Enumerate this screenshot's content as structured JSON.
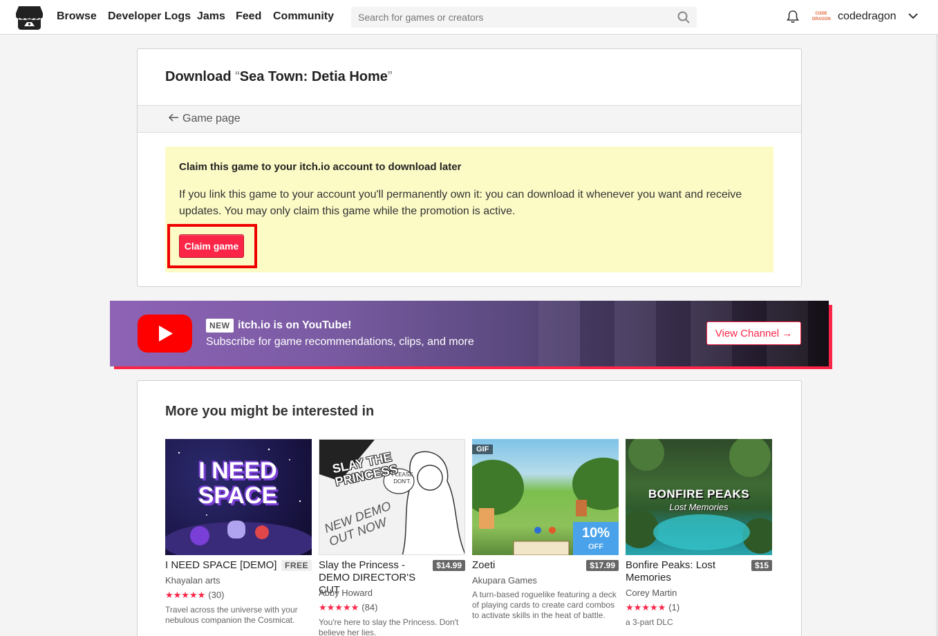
{
  "header": {
    "logo_name": "itch-io-logo",
    "nav": [
      "Browse",
      "Developer Logs",
      "Jams",
      "Feed",
      "Community"
    ],
    "search_placeholder": "Search for games or creators",
    "username": "codedragon",
    "avatar_text": "CODE DRAGON"
  },
  "download": {
    "title_prefix": "Download",
    "open_quote": "“",
    "game_title": "Sea Town: Detia Home",
    "close_quote": "”",
    "back_label": "Game page",
    "claim_heading": "Claim this game to your itch.io account to download later",
    "claim_description": "If you link this game to your account you'll permanently own it: you can download it whenever you want and receive updates. You may only claim this game while the promotion is active.",
    "claim_button": "Claim game"
  },
  "youtube": {
    "badge": "NEW",
    "headline": "itch.io is on YouTube!",
    "subtitle": "Subscribe for game recommendations, clips, and more",
    "button": "View Channel →"
  },
  "recommendations": {
    "title": "More you might be interested in",
    "games": [
      {
        "title": "I NEED SPACE [DEMO]",
        "price": "FREE",
        "author": "Khayalan arts",
        "stars": "★★★★★",
        "rating_count": "(30)",
        "description": "Travel across the universe with your nebulous companion the Cosmicat.",
        "cover_text": "I NEED SPACE"
      },
      {
        "title": "Slay the Princess - DEMO DIRECTOR'S CUT",
        "price": "$14.99",
        "author": "Abby Howard",
        "stars": "★★★★★",
        "rating_count": "(84)",
        "description": "You're here to slay the Princess. Don't believe her lies.",
        "cover_text": "SLAY THE PRINCESS",
        "cover_sub": "NEW DEMO OUT NOW",
        "cover_bubble": "PLEASE DON'T."
      },
      {
        "title": "Zoeti",
        "price": "$17.99",
        "author": "Akupara Games",
        "description": "A turn-based roguelike featuring a deck of playing cards to create card combos to activate skills in the heat of battle.",
        "gif_badge": "GIF",
        "discount_pct": "10%",
        "discount_off": "OFF"
      },
      {
        "title": "Bonfire Peaks: Lost Memories",
        "price": "$15",
        "author": "Corey Martin",
        "stars": "★★★★★",
        "rating_count": "(1)",
        "description": "a 3-part DLC",
        "cover_text": "BONFIRE PEAKS",
        "cover_sub": "Lost Memories"
      }
    ]
  },
  "colors": {
    "accent": "#fa2547",
    "highlight": "#fcfbc6",
    "discount": "#4aa3ea"
  }
}
